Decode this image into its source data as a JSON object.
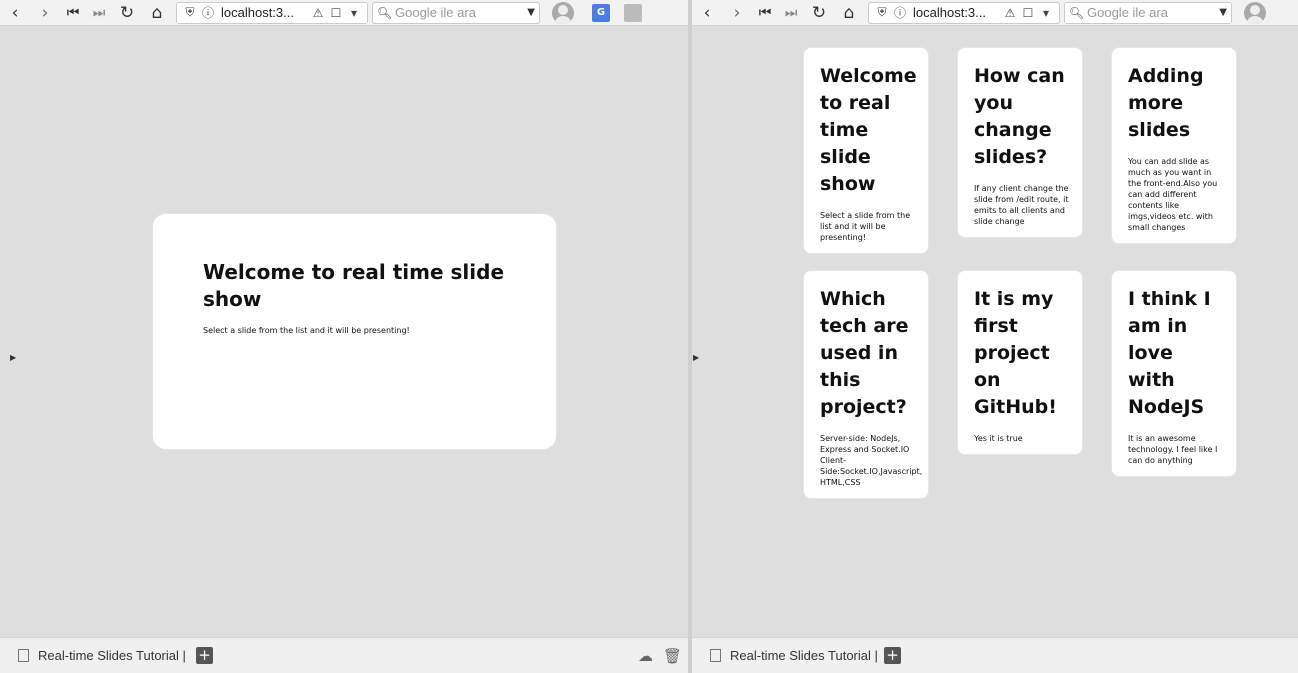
{
  "browser": {
    "url": "localhost:3...",
    "search_placeholder": "Google ile ara",
    "tab_title": "Real-time Slides Tutorial | S"
  },
  "presenter": {
    "title": "Welcome to real time slide show",
    "text": "Select a slide from the list and it will be presenting!"
  },
  "slides": [
    {
      "title": "Welcome to real time slide show",
      "text": "Select a slide from the list and it will be presenting!"
    },
    {
      "title": "How can you change slides?",
      "text": "If any client change the slide from /edit route, it emits to all clients and slide change"
    },
    {
      "title": "Adding more slides",
      "text": "You can add slide as much as you want in the front-end.Also you can add different contents like imgs,videos etc. with small changes"
    },
    {
      "title": "Which tech are used in this project?",
      "text": "Server-side: NodeJs, Express and Socket.IO Client-Side:Socket.IO,Javascript, HTML,CSS"
    },
    {
      "title": "It is my first project on GitHub!",
      "text": "Yes it is true"
    },
    {
      "title": "I think I am in love with NodeJS",
      "text": "It is an awesome technology. I feel like I can do anything"
    }
  ],
  "icons": {
    "back": "back-icon",
    "forward": "forward-icon",
    "first": "first-page-icon",
    "last": "last-page-icon",
    "reload": "reload-icon",
    "home": "home-icon",
    "shield": "shield-icon",
    "info": "info-icon",
    "warning": "warning-icon",
    "bookmark": "bookmark-icon",
    "dropdown": "dropdown-icon",
    "search": "search-icon",
    "profile": "profile-avatar-icon",
    "translate": "translate-icon",
    "cloud": "cloud-icon",
    "trash": "trash-icon",
    "add-tab": "add-tab-icon",
    "document": "document-icon"
  }
}
